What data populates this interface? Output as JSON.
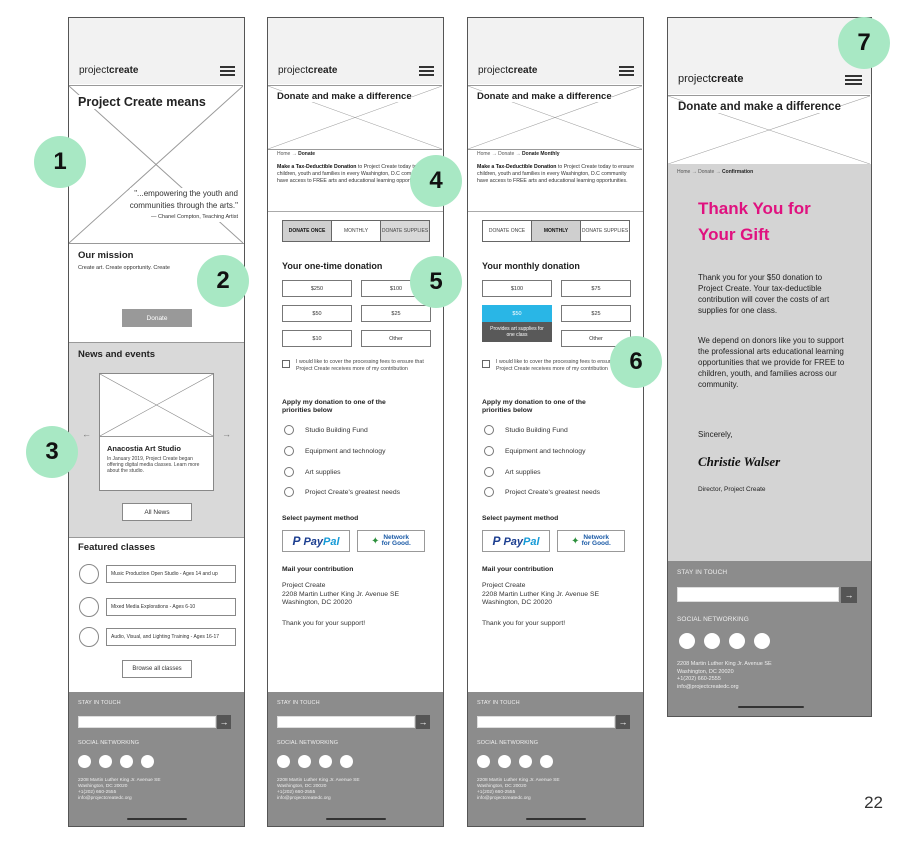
{
  "page_number": "22",
  "badges": [
    "1",
    "2",
    "3",
    "4",
    "5",
    "6",
    "7"
  ],
  "logo": {
    "light": "project",
    "bold": "create"
  },
  "screen1": {
    "hero_title": "Project Create means",
    "quote_line1": "\"...empowering the youth and",
    "quote_line2": "communities through the arts.\"",
    "quote_attr": "— Chanel Compton, Teaching Artist",
    "mission_title": "Our mission",
    "mission_text": "Create art. Create opportunity. Create",
    "donate_button": "Donate",
    "news_title": "News and events",
    "news_card_title": "Anacostia Art Studio",
    "news_card_text": "In January 2019, Project Create began offering digital media classes. Learn more about the studio.",
    "prev_arrow": "←",
    "next_arrow": "→",
    "all_news_button": "All News",
    "classes_title": "Featured classes",
    "classes": [
      "Music Production Open Studio - Ages 14 and up",
      "Mixed Media Explorations - Ages 6-10",
      "Audio, Visual, and Lighting Training - Ages 16-17"
    ],
    "browse_button": "Browse all classes"
  },
  "donate_common": {
    "hero_title": "Donate and make a difference",
    "crumb_home": "Home",
    "crumb_sep": "→",
    "crumb_donate": "Donate",
    "intro_bold": "Make a Tax-Deductible Donation",
    "intro_rest": "to Project Create today to ensure children, youth and families in every Washington, D.C community have access to FREE arts and educational learning opportunities.",
    "tabs": [
      "DONATE ONCE",
      "MONTHLY",
      "DONATE SUPPLIES"
    ],
    "cover_fees": "I would like to cover the processing fees to ensure that Project Create receives more of my contribution",
    "apply_title": "Apply my donation to one of the priorities below",
    "priorities": [
      "Studio Building Fund",
      "Equipment and technology",
      "Art supplies",
      "Project Create's greatest needs"
    ],
    "payment_title": "Select payment method",
    "paypal_pay": "Pay",
    "paypal_pal": "Pal",
    "network_line1": "Network",
    "network_line2": "for Good.",
    "mail_title": "Mail your contribution",
    "mail_name": "Project Create",
    "mail_street": "2208 Martin Luther King Jr. Avenue SE",
    "mail_city": "Washington, DC 20020",
    "thanks": "Thank you for your support!"
  },
  "screen2": {
    "crumb_current": "Donate",
    "donation_title": "Your one-time donation",
    "amounts": [
      "$250",
      "$100",
      "$50",
      "$25",
      "$10",
      "Other"
    ]
  },
  "screen3": {
    "crumb_current": "Donate Monthly",
    "donation_title": "Your monthly donation",
    "amounts": [
      "$100",
      "$75",
      "$50",
      "$25",
      "Other"
    ],
    "tooltip": "Provides art supplies for one class"
  },
  "screen4": {
    "crumb_current": "Confirmation",
    "thank_title_1": "Thank You for",
    "thank_title_2": "Your Gift",
    "para1": "Thank you for your $50 donation to Project Create.  Your tax-deductible contribution will cover the costs of art supplies for one class.",
    "para2": "We depend on donors like you to support the professional arts educational learning opportunities that we provide for FREE to children, youth, and families across our community.",
    "sincerely": "Sincerely,",
    "signature": "Christie Walser",
    "signer_title": "Director, Project Create",
    "accent": "#e0117f"
  },
  "footer": {
    "stay_label": "STAY IN TOUCH",
    "submit_arrow": "→",
    "social_label": "SOCIAL NETWORKING",
    "addr1": "2208 Martin Luther King Jr. Avenue SE",
    "addr2": "Washington, DC 20020",
    "addr3": "+1(202) 660-2555",
    "addr4": "info@projectcreatedc.org"
  }
}
